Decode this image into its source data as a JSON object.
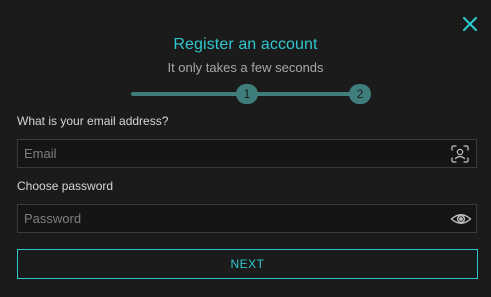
{
  "dialog": {
    "title": "Register an account",
    "subtitle": "It only takes a few seconds"
  },
  "stepper": {
    "steps": [
      "1",
      "2"
    ],
    "current_step": 1,
    "color": "#3f7e7b"
  },
  "form": {
    "email_label": "What is your email address?",
    "email_placeholder": "Email",
    "email_value": "",
    "email_icon": "face-scan-icon",
    "password_label": "Choose password",
    "password_placeholder": "Password",
    "password_value": "",
    "password_icon": "eye-icon"
  },
  "actions": {
    "next_label": "NEXT",
    "close_icon": "close-icon"
  },
  "theme": {
    "accent": "#2ec7cf",
    "background": "#1b1b1b"
  }
}
